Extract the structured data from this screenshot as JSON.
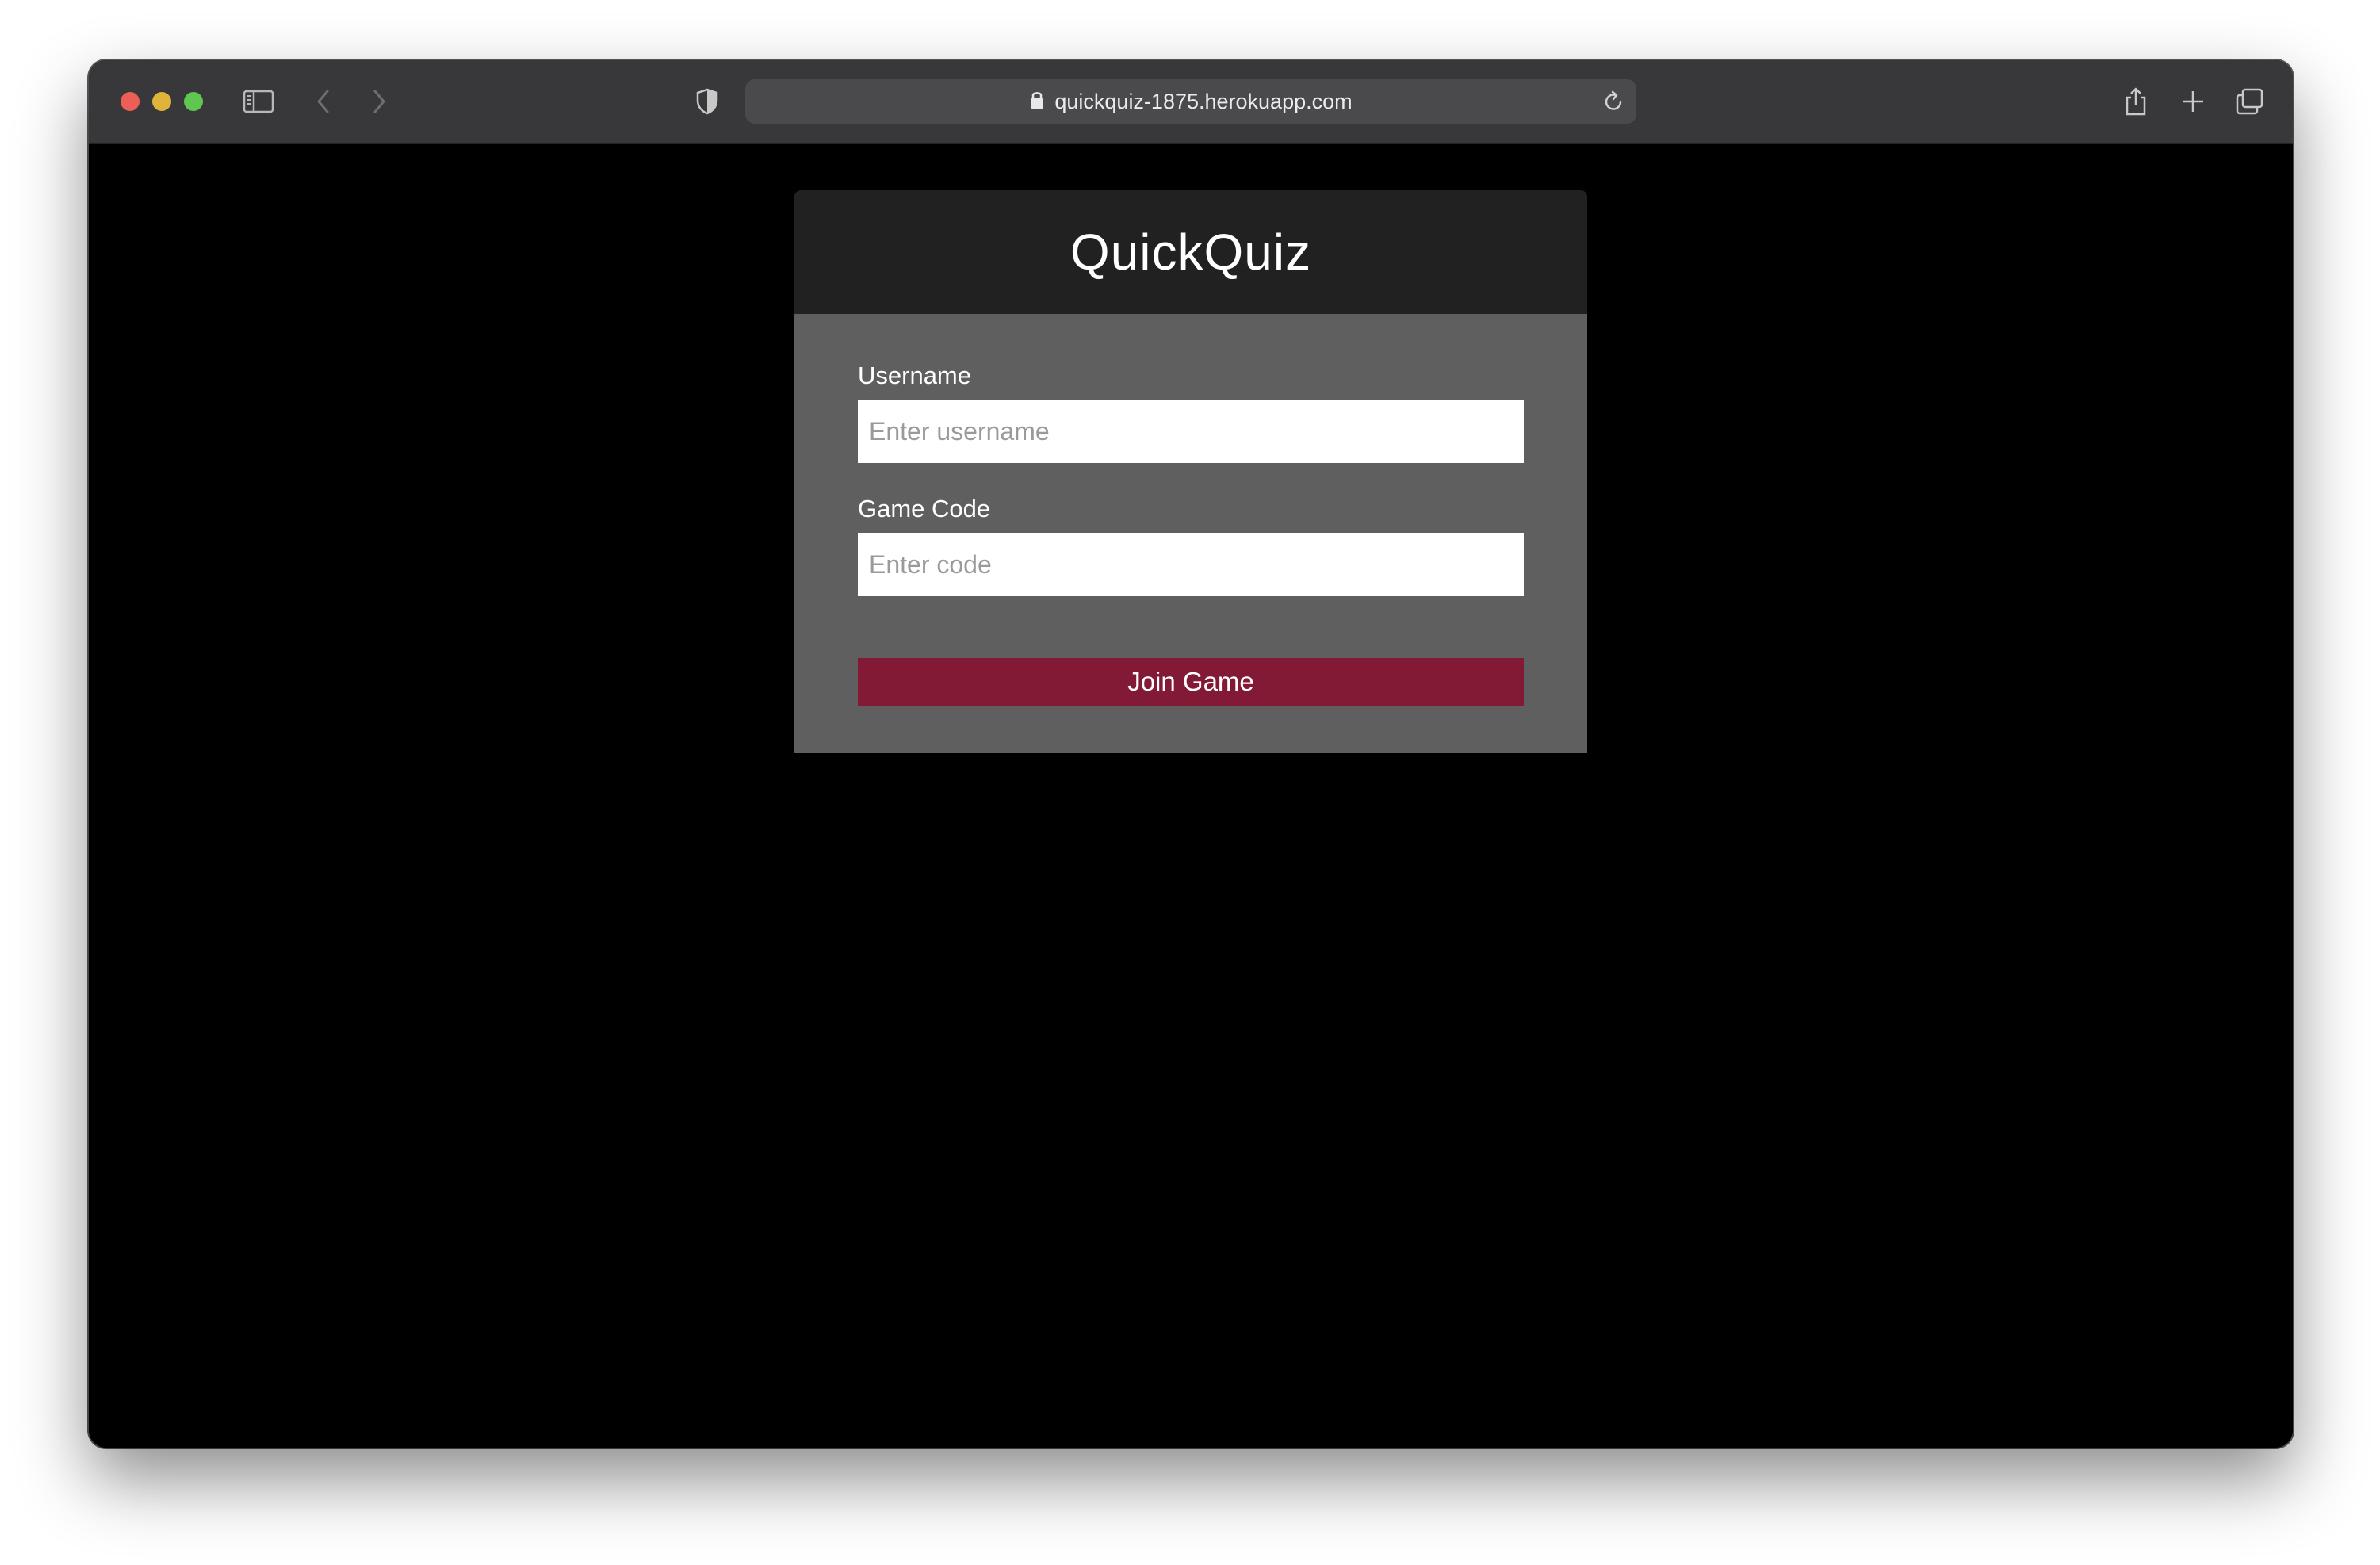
{
  "browser": {
    "url": "quickquiz-1875.herokuapp.com",
    "icons": {
      "sidebar": "sidebar-icon",
      "back": "chevron-left-icon",
      "forward": "chevron-right-icon",
      "privacy": "shield-icon",
      "lock": "lock-icon",
      "reload": "reload-icon",
      "share": "share-icon",
      "new_tab": "plus-icon",
      "tabs": "tabs-overview-icon"
    },
    "colors": {
      "close": "#ec5f57",
      "minimize": "#e0b43a",
      "maximize": "#5fc750"
    }
  },
  "page": {
    "title": "QuickQuiz",
    "username": {
      "label": "Username",
      "placeholder": "Enter username",
      "value": ""
    },
    "game_code": {
      "label": "Game Code",
      "placeholder": "Enter code",
      "value": ""
    },
    "join_button": "Join Game",
    "colors": {
      "header_bg": "#212121",
      "body_bg": "#5f5f5f",
      "button_bg": "#831a35",
      "page_bg": "#000000"
    }
  }
}
